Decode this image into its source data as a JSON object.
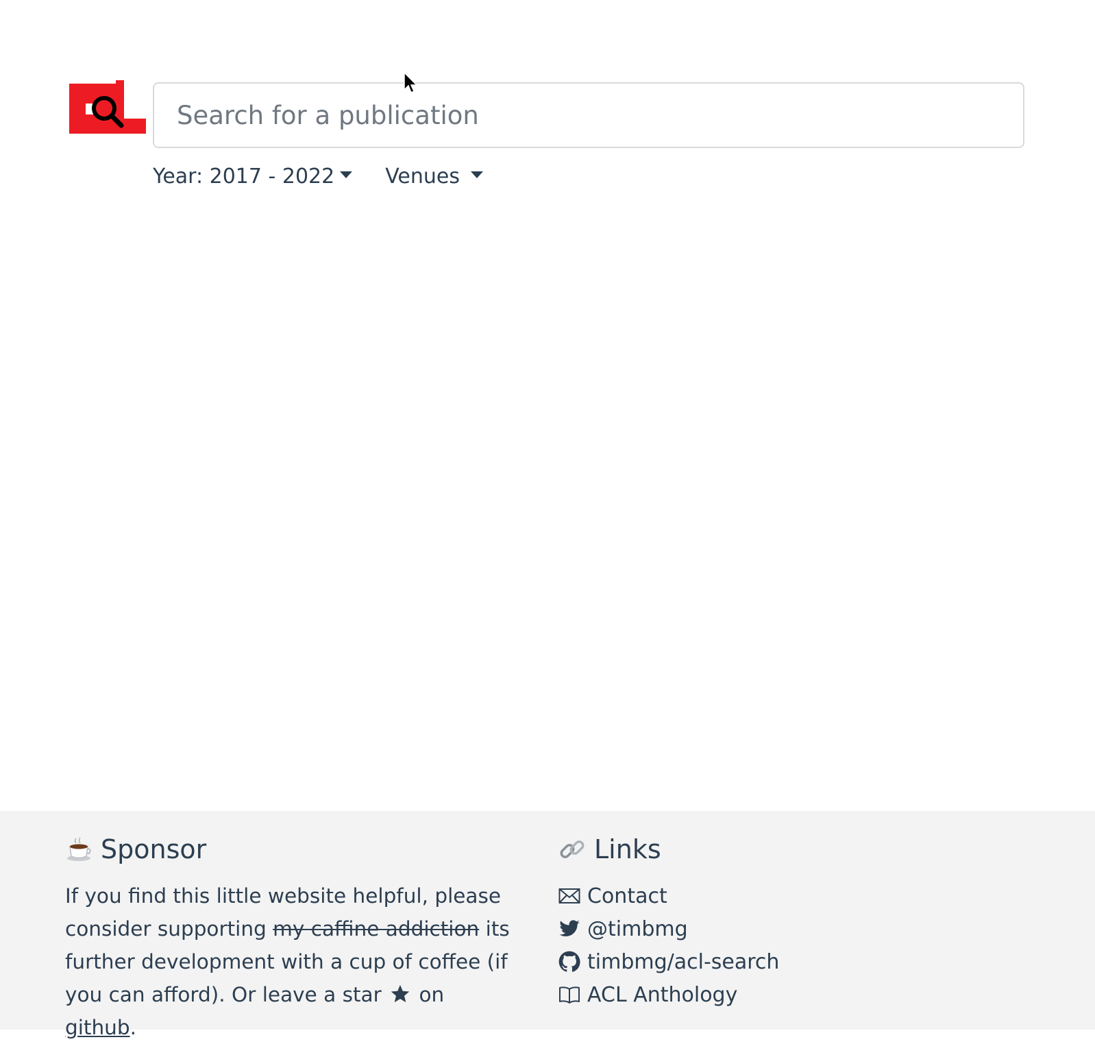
{
  "search": {
    "placeholder": "Search for a publication",
    "value": ""
  },
  "filters": {
    "year_label": "Year: 2017 - 2022",
    "venues_label": "Venues"
  },
  "footer": {
    "sponsor": {
      "heading": "Sponsor",
      "text_before": "If you find this little website helpful, please consider supporting ",
      "struck_text": "my caffine addiction",
      "text_middle": " its further development with a cup of coffee (if you can afford). Or leave a star ",
      "text_on": " on ",
      "github_link": "github",
      "text_end": "."
    },
    "links": {
      "heading": "Links",
      "items": [
        {
          "label": "Contact",
          "icon": "envelope-icon"
        },
        {
          "label": "@timbmg",
          "icon": "twitter-icon"
        },
        {
          "label": "timbmg/acl-search",
          "icon": "github-icon"
        },
        {
          "label": "ACL Anthology",
          "icon": "book-icon"
        }
      ]
    }
  },
  "colors": {
    "brand_red": "#ed1c24",
    "text": "#2c3e50",
    "footer_bg": "#f3f3f3"
  }
}
